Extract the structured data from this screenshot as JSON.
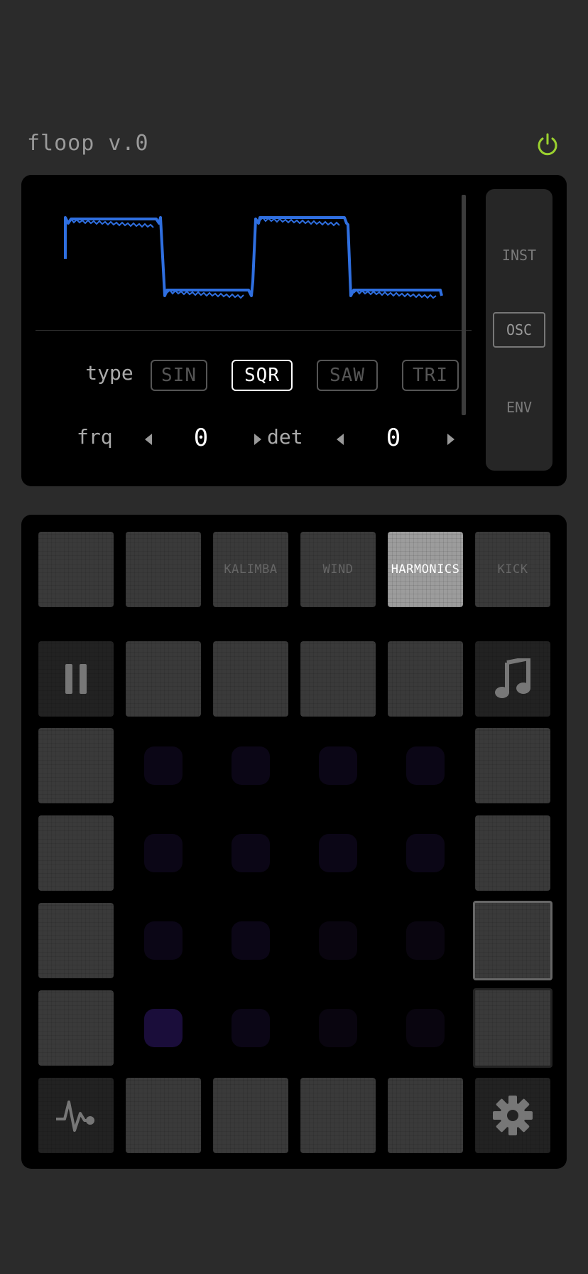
{
  "app": {
    "title": "floop v.0",
    "power_icon": "power-icon",
    "accent_color": "#9bd12f",
    "wave_color": "#2f6fe0"
  },
  "synth": {
    "type_label": "type",
    "wave_types": [
      {
        "label": "SIN",
        "active": false
      },
      {
        "label": "SQR",
        "active": true
      },
      {
        "label": "SAW",
        "active": false
      },
      {
        "label": "TRI",
        "active": false
      }
    ],
    "frq_label": "frq",
    "frq_value": "0",
    "det_label": "det",
    "det_value": "0",
    "side_tabs": [
      {
        "label": "INST",
        "active": false
      },
      {
        "label": "OSC",
        "active": true
      },
      {
        "label": "ENV",
        "active": false
      }
    ]
  },
  "pads": {
    "instruments": [
      "",
      "",
      "KALIMBA",
      "WIND",
      "HARMONICS",
      "KICK"
    ],
    "selected_instrument": "HARMONICS",
    "icons": {
      "pause": "pause-icon",
      "music": "music-note-icon",
      "pulse": "pulse-icon",
      "settings": "gear-icon"
    }
  }
}
